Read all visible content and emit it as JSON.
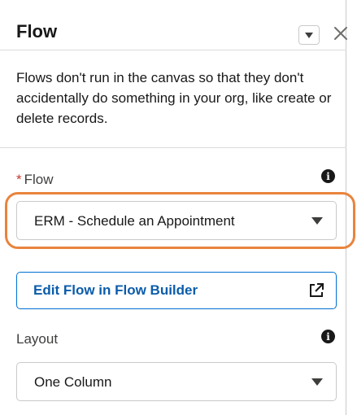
{
  "panel": {
    "title": "Flow",
    "description": "Flows don't run in the canvas so that they don't accidentally do something in your org, like create or delete records."
  },
  "flow_field": {
    "required_marker": "*",
    "label": "Flow",
    "value": "ERM - Schedule an Appointment"
  },
  "edit_button": {
    "label": "Edit Flow in Flow Builder"
  },
  "layout_field": {
    "label": "Layout",
    "value": "One Column"
  },
  "info_glyph": "i",
  "colors": {
    "highlight": "#e9843d",
    "link": "#0b5cab",
    "required": "#c23934"
  }
}
